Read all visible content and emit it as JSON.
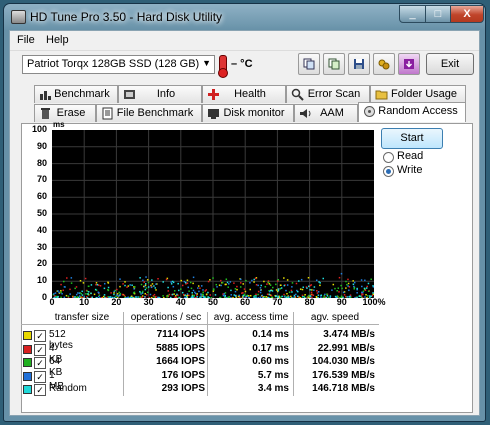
{
  "window": {
    "title": "HD Tune Pro 3.50 - Hard Disk Utility",
    "minimize_label": "_",
    "maximize_label": "□",
    "close_label": "X"
  },
  "menu": {
    "file": "File",
    "help": "Help"
  },
  "toolbar": {
    "drive": "Patriot Torqx 128GB SSD (128 GB)",
    "temperature": "– °C",
    "exit_label": "Exit",
    "icons": [
      "copy-info-icon",
      "copy-screen-icon",
      "save-icon",
      "options-icon",
      "download-icon"
    ]
  },
  "tabs_top": [
    {
      "label": "Benchmark",
      "icon": "benchmark-icon"
    },
    {
      "label": "Info",
      "icon": "info-icon"
    },
    {
      "label": "Health",
      "icon": "health-icon"
    },
    {
      "label": "Error Scan",
      "icon": "error-scan-icon"
    },
    {
      "label": "Folder Usage",
      "icon": "folder-usage-icon"
    }
  ],
  "tabs_bottom": [
    {
      "label": "Erase",
      "icon": "erase-icon"
    },
    {
      "label": "File Benchmark",
      "icon": "file-benchmark-icon"
    },
    {
      "label": "Disk monitor",
      "icon": "disk-monitor-icon"
    },
    {
      "label": "AAM",
      "icon": "aam-icon"
    },
    {
      "label": "Random Access",
      "icon": "random-access-icon",
      "active": true
    }
  ],
  "controls": {
    "start_label": "Start",
    "read_label": "Read",
    "write_label": "Write",
    "selected": "Write"
  },
  "chart_data": {
    "type": "scatter",
    "ylabel": "ms",
    "ylim": [
      0,
      100
    ],
    "y_ticks": [
      "100",
      "90",
      "80",
      "70",
      "60",
      "50",
      "40",
      "30",
      "20",
      "10",
      "0"
    ],
    "xlim": [
      0,
      100
    ],
    "x_ticks": [
      "0",
      "10",
      "20",
      "30",
      "40",
      "50",
      "60",
      "70",
      "80",
      "90",
      "100%"
    ],
    "grid": true,
    "background": "#000000",
    "series_colors": [
      "#e8e000",
      "#e02020",
      "#20c020",
      "#2080e0",
      "#20e0e0"
    ],
    "description_range_ms": [
      0,
      12
    ]
  },
  "results": {
    "headers": [
      "transfer size",
      "operations / sec",
      "avg. access time",
      "agv. speed"
    ],
    "rows": [
      {
        "label": "512 bytes",
        "color": "#e8d800",
        "checked": true,
        "ops": "7114 IOPS",
        "access": "0.14 ms",
        "speed": "3.474 MB/s"
      },
      {
        "label": "4 KB",
        "color": "#d82020",
        "checked": true,
        "ops": "5885 IOPS",
        "access": "0.17 ms",
        "speed": "22.991 MB/s"
      },
      {
        "label": "64 KB",
        "color": "#20b020",
        "checked": true,
        "ops": "1664 IOPS",
        "access": "0.60 ms",
        "speed": "104.030 MB/s"
      },
      {
        "label": "1 MB",
        "color": "#2070d8",
        "checked": true,
        "ops": "176 IOPS",
        "access": "5.7 ms",
        "speed": "176.539 MB/s"
      },
      {
        "label": "Random",
        "color": "#20d8d8",
        "checked": true,
        "ops": "293 IOPS",
        "access": "3.4 ms",
        "speed": "146.718 MB/s"
      }
    ]
  }
}
